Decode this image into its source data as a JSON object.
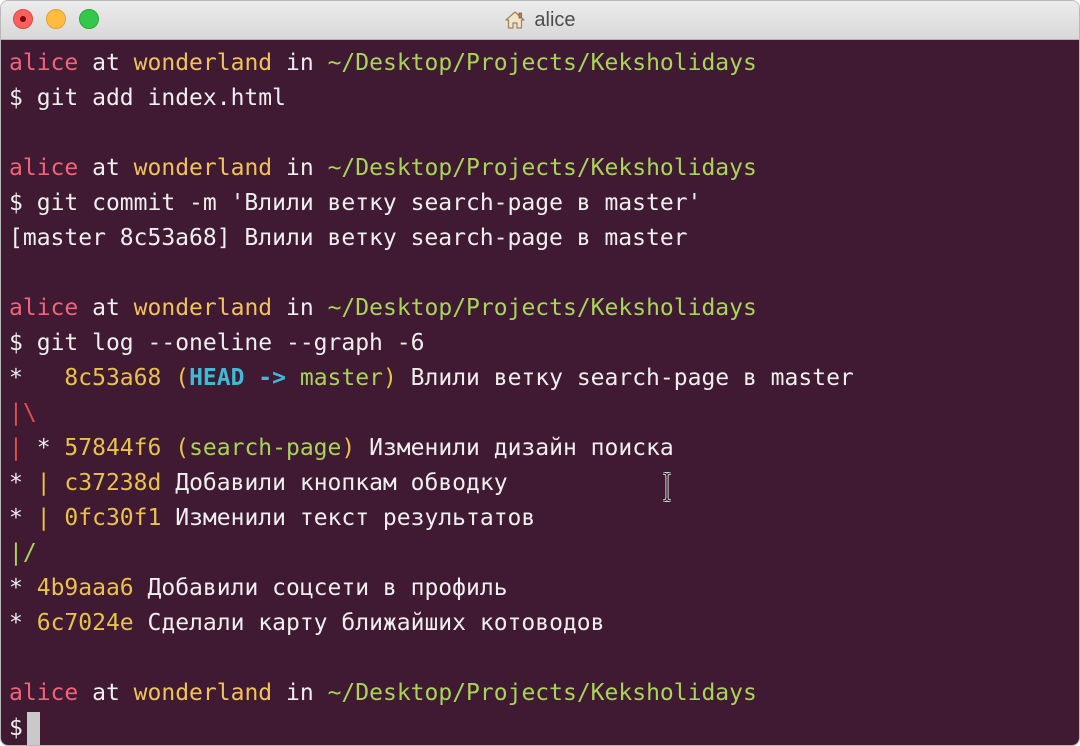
{
  "window": {
    "title": "alice"
  },
  "prompt": {
    "user": "alice",
    "at": "at",
    "host": "wonderland",
    "in": "in",
    "path": "~/Desktop/Projects/Keksholidays",
    "symbol": "$"
  },
  "commands": {
    "cmd1": "git add index.html",
    "cmd2": "git commit -m 'Влили ветку search-page в master'",
    "cmd3": "git log --oneline --graph -6"
  },
  "outputs": {
    "commit_result": "[master 8c53a68] Влили ветку search-page в master"
  },
  "log": [
    {
      "graph": "*",
      "hash": "8c53a68",
      "ref_open": "(",
      "head": "HEAD",
      "arrow": " -> ",
      "branch": "master",
      "ref_close": ")",
      "message": "Влили ветку search-page в master"
    },
    {
      "graph": "|\\"
    },
    {
      "graph_pipe": "|",
      "graph_star": " * ",
      "hash": "57844f6",
      "ref_open": "(",
      "branch": "search-page",
      "ref_close": ")",
      "message": "Изменили дизайн поиска"
    },
    {
      "graph_star": "* ",
      "graph_pipe": "|",
      "hash": "c37238d",
      "message": "Добавили кнопкам обводку"
    },
    {
      "graph_star": "* ",
      "graph_pipe": "|",
      "hash": "0fc30f1",
      "message": "Изменили текст результатов"
    },
    {
      "graph": "|/"
    },
    {
      "graph": "*",
      "hash": "4b9aaa6",
      "message": "Добавили соцсети в профиль"
    },
    {
      "graph": "*",
      "hash": "6c7024e",
      "message": "Сделали карту ближайших котоводов"
    }
  ],
  "colors": {
    "background": "#3f1a32",
    "user": "#f2637a",
    "host": "#f0c35a",
    "path": "#a8d45a",
    "hash": "#e8c24a",
    "head": "#3fb9d6"
  }
}
